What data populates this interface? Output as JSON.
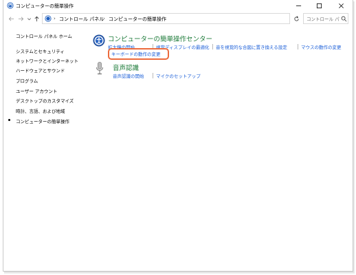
{
  "window": {
    "title": "コンピューターの簡単操作"
  },
  "address": {
    "crumbs": [
      "コントロール パネル",
      "コンピューターの簡単操作"
    ]
  },
  "search": {
    "placeholder": "コントロール パ..."
  },
  "sidebar": {
    "items": [
      {
        "label": "コントロール パネル ホーム",
        "current": false
      },
      {
        "label": "システムとセキュリティ",
        "current": false
      },
      {
        "label": "ネットワークとインターネット",
        "current": false
      },
      {
        "label": "ハードウェアとサウンド",
        "current": false
      },
      {
        "label": "プログラム",
        "current": false
      },
      {
        "label": "ユーザー アカウント",
        "current": false
      },
      {
        "label": "デスクトップのカスタマイズ",
        "current": false
      },
      {
        "label": "時計、言語、および地域",
        "current": false
      },
      {
        "label": "コンピューターの簡単操作",
        "current": true
      }
    ]
  },
  "main": {
    "ease_center": {
      "title": "コンピューターの簡単操作センター",
      "links": [
        "拡大鏡の開始",
        "視覚ディスプレイの最適化",
        "音を視覚的な合図に置き換える設定",
        "マウスの動作の変更",
        "キーボードの動作の変更"
      ]
    },
    "speech": {
      "title": "音声認識",
      "links": [
        "音声認識の開始",
        "マイクのセットアップ"
      ]
    }
  },
  "colors": {
    "link": "#1a5ed8",
    "section_title": "#1e7b3a",
    "highlight": "#ec6a3c"
  },
  "icons": {
    "app": "ease-of-access-icon",
    "speech": "microphone-icon"
  }
}
